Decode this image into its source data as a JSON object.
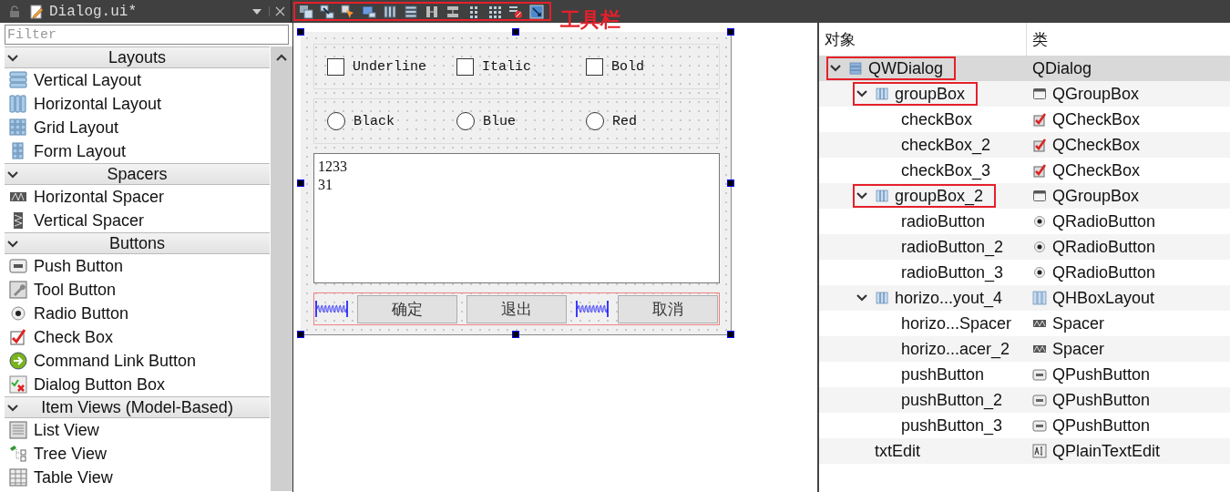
{
  "dock": {
    "title": "Dialog.ui*",
    "filter": {
      "placeholder": "Filter"
    }
  },
  "widget_box": [
    {
      "label": "Layouts",
      "expanded": true,
      "items": [
        {
          "label": "Vertical Layout",
          "kind": "vbox"
        },
        {
          "label": "Horizontal Layout",
          "kind": "hbox"
        },
        {
          "label": "Grid Layout",
          "kind": "grid"
        },
        {
          "label": "Form Layout",
          "kind": "form"
        }
      ]
    },
    {
      "label": "Spacers",
      "expanded": true,
      "items": [
        {
          "label": "Horizontal Spacer",
          "kind": "hspacer"
        },
        {
          "label": "Vertical Spacer",
          "kind": "vspacer"
        }
      ]
    },
    {
      "label": "Buttons",
      "expanded": true,
      "items": [
        {
          "label": "Push Button",
          "kind": "push"
        },
        {
          "label": "Tool Button",
          "kind": "tool"
        },
        {
          "label": "Radio Button",
          "kind": "radio"
        },
        {
          "label": "Check Box",
          "kind": "check"
        },
        {
          "label": "Command Link Button",
          "kind": "command"
        },
        {
          "label": "Dialog Button Box",
          "kind": "dialogbox"
        }
      ]
    },
    {
      "label": "Item Views (Model-Based)",
      "expanded": true,
      "items": [
        {
          "label": "List View",
          "kind": "list"
        },
        {
          "label": "Tree View",
          "kind": "tree"
        },
        {
          "label": "Table View",
          "kind": "table"
        }
      ]
    }
  ],
  "toolbar": {
    "annotation": "工具栏"
  },
  "form": {
    "checkboxes": [
      {
        "label": "Underline",
        "checked": false
      },
      {
        "label": "Italic",
        "checked": false
      },
      {
        "label": "Bold",
        "checked": false
      }
    ],
    "radios": [
      {
        "label": "Black",
        "selected": false
      },
      {
        "label": "Blue",
        "selected": false
      },
      {
        "label": "Red",
        "selected": false
      }
    ],
    "text_edit": {
      "lines": [
        "1233",
        "31"
      ]
    },
    "button_row": [
      {
        "kind": "spacer"
      },
      {
        "kind": "button",
        "label": "确定"
      },
      {
        "kind": "button",
        "label": "退出"
      },
      {
        "kind": "spacer"
      },
      {
        "kind": "button",
        "label": "取消"
      }
    ]
  },
  "inspector": {
    "columns": [
      "对象",
      "类"
    ],
    "tree": [
      {
        "name": "QWDialog",
        "class": "QDialog",
        "expanded": true,
        "selected": true,
        "highlighted": true,
        "children": [
          {
            "name": "groupBox",
            "class": "QGroupBox",
            "kind": "groupbox",
            "expanded": true,
            "selected": false,
            "highlighted": true,
            "children": [
              {
                "name": "checkBox",
                "class": "QCheckBox",
                "kind": "checkbox",
                "selected": false,
                "highlighted": false
              },
              {
                "name": "checkBox_2",
                "class": "QCheckBox",
                "kind": "checkbox",
                "selected": false,
                "highlighted": false
              },
              {
                "name": "checkBox_3",
                "class": "QCheckBox",
                "kind": "checkbox",
                "selected": false,
                "highlighted": false
              }
            ]
          },
          {
            "name": "groupBox_2",
            "class": "QGroupBox",
            "kind": "groupbox",
            "expanded": true,
            "selected": false,
            "highlighted": true,
            "children": [
              {
                "name": "radioButton",
                "class": "QRadioButton",
                "kind": "radio",
                "selected": false,
                "highlighted": false
              },
              {
                "name": "radioButton_2",
                "class": "QRadioButton",
                "kind": "radio",
                "selected": false,
                "highlighted": false
              },
              {
                "name": "radioButton_3",
                "class": "QRadioButton",
                "kind": "radio",
                "selected": false,
                "highlighted": false
              }
            ]
          },
          {
            "name": "horizo...yout_4",
            "class": "QHBoxLayout",
            "kind": "hlayout",
            "expanded": true,
            "selected": false,
            "highlighted": false,
            "children": [
              {
                "name": "horizo...Spacer",
                "class": "Spacer",
                "kind": "spacer",
                "selected": false,
                "highlighted": false
              },
              {
                "name": "horizo...acer_2",
                "class": "Spacer",
                "kind": "spacer",
                "selected": false,
                "highlighted": false
              },
              {
                "name": "pushButton",
                "class": "QPushButton",
                "kind": "pushbutton",
                "selected": false,
                "highlighted": false
              },
              {
                "name": "pushButton_2",
                "class": "QPushButton",
                "kind": "pushbutton",
                "selected": false,
                "highlighted": false
              },
              {
                "name": "pushButton_3",
                "class": "QPushButton",
                "kind": "pushbutton",
                "selected": false,
                "highlighted": false
              }
            ]
          },
          {
            "name": "txtEdit",
            "class": "QPlainTextEdit",
            "kind": "textedit",
            "selected": false,
            "highlighted": false
          }
        ]
      }
    ]
  }
}
